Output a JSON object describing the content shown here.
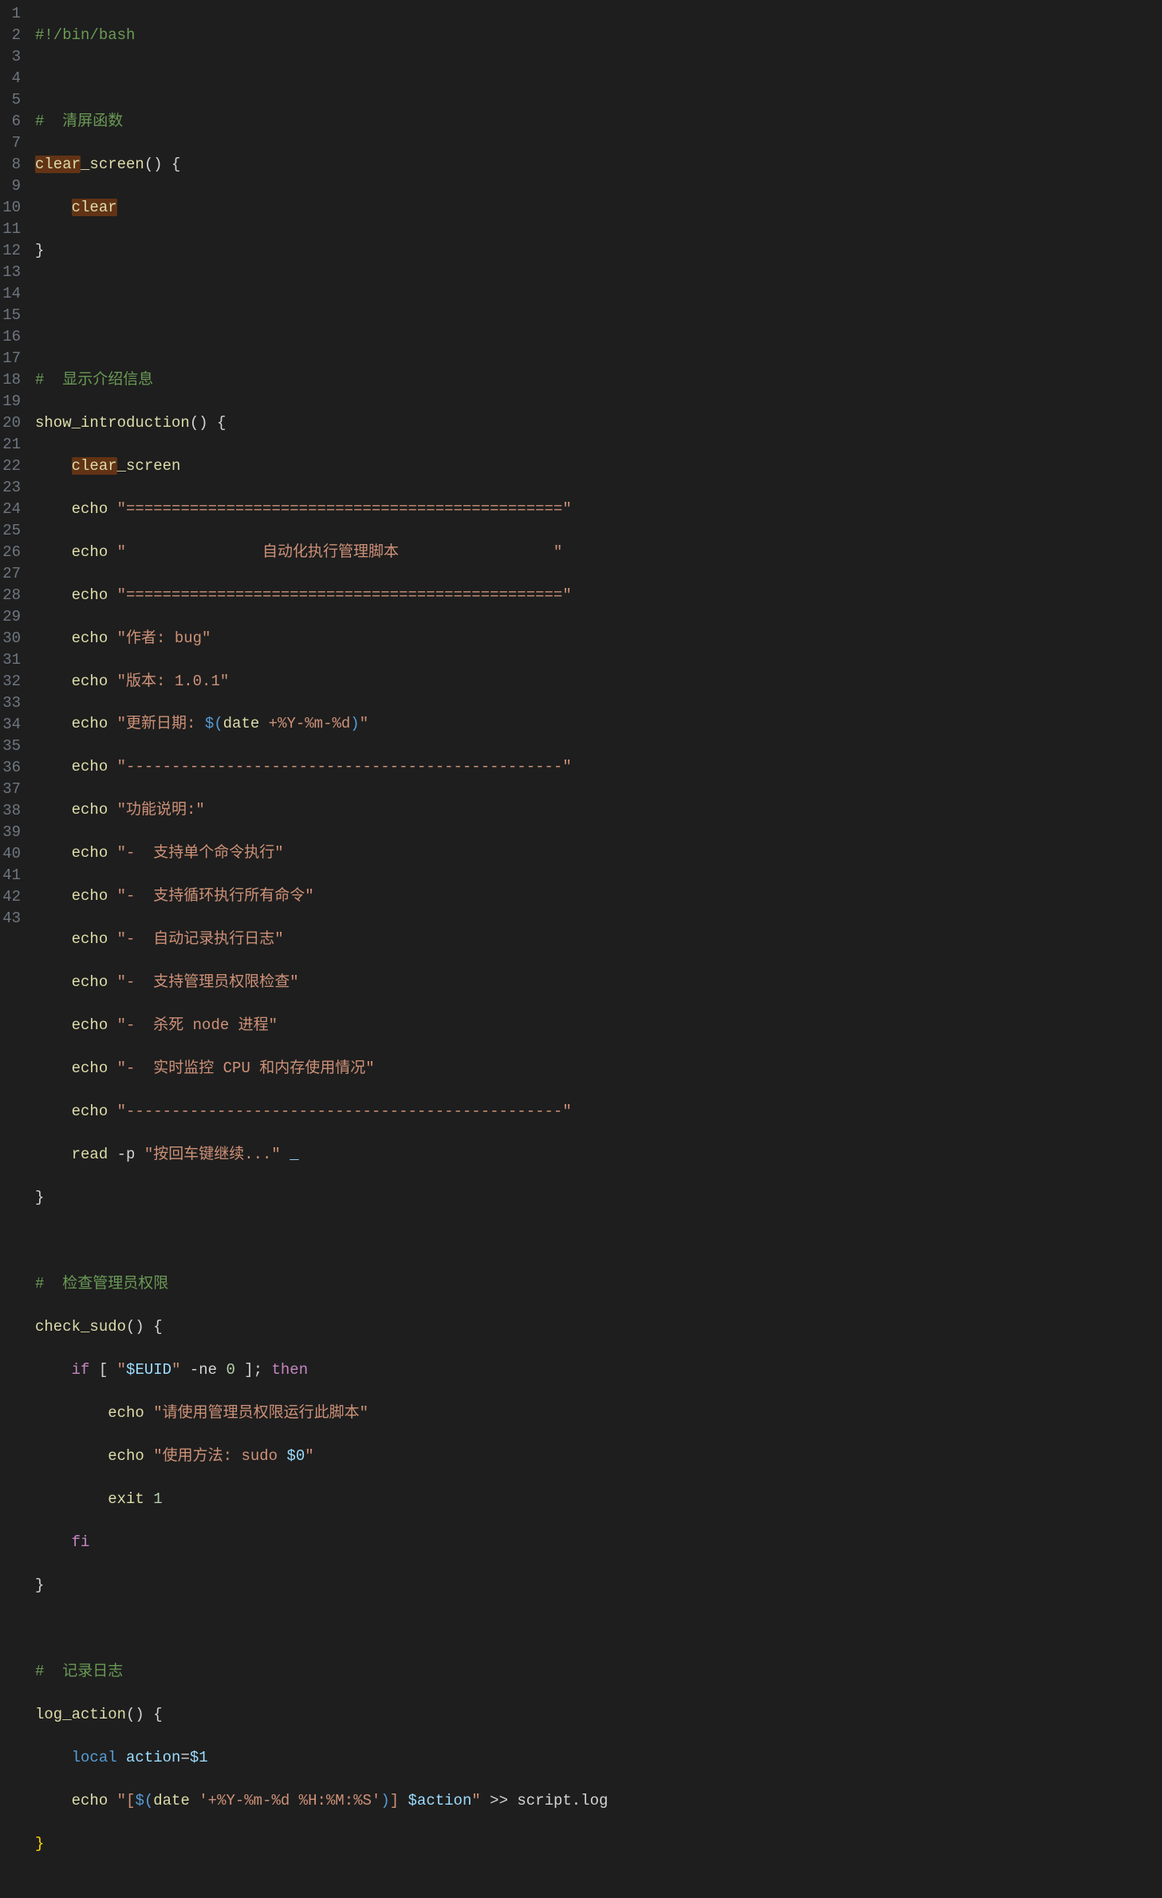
{
  "editor": {
    "line_start": 1,
    "line_end": 43
  },
  "lines": {
    "l1": "#!/bin/bash",
    "l3_comment": "#  清屏函数",
    "l4_fn": "clear",
    "l4_rest": "_screen",
    "l4_paren": "() {",
    "l5_clear": "clear",
    "l6_close": "}",
    "l9_comment": "#  显示介绍信息",
    "l10_fn": "show_introduction",
    "l10_paren": "() {",
    "l11_clear": "clear",
    "l11_rest": "_screen",
    "l12_echo": "echo",
    "l12_str": "\"================================================\"",
    "l13_echo": "echo",
    "l13_str": "\"               自动化执行管理脚本                 \"",
    "l14_echo": "echo",
    "l14_str": "\"================================================\"",
    "l15_echo": "echo",
    "l15_str": "\"作者: bug\"",
    "l16_echo": "echo",
    "l16_str": "\"版本: 1.0.1\"",
    "l17_echo": "echo",
    "l17_str_a": "\"更新日期: ",
    "l17_sub_open": "$(",
    "l17_date": "date",
    "l17_fmt": " +%Y-%m-%d",
    "l17_sub_close": ")",
    "l17_str_b": "\"",
    "l18_echo": "echo",
    "l18_str": "\"------------------------------------------------\"",
    "l19_echo": "echo",
    "l19_str": "\"功能说明:\"",
    "l20_echo": "echo",
    "l20_str": "\"-  支持单个命令执行\"",
    "l21_echo": "echo",
    "l21_str": "\"-  支持循环执行所有命令\"",
    "l22_echo": "echo",
    "l22_str": "\"-  自动记录执行日志\"",
    "l23_echo": "echo",
    "l23_str": "\"-  支持管理员权限检查\"",
    "l24_echo": "echo",
    "l24_str": "\"-  杀死 node 进程\"",
    "l25_echo": "echo",
    "l25_str": "\"-  实时监控 CPU 和内存使用情况\"",
    "l26_echo": "echo",
    "l26_str": "\"------------------------------------------------\"",
    "l27_read": "read",
    "l27_flag": " -p ",
    "l27_str": "\"按回车键继续...\"",
    "l27_var": " _",
    "l28_close": "}",
    "l30_comment": "#  检查管理员权限",
    "l31_fn": "check_sudo",
    "l31_paren": "() {",
    "l32_if": "if",
    "l32_bo": " [ ",
    "l32_q1": "\"",
    "l32_var": "$EUID",
    "l32_q2": "\"",
    "l32_op": " -ne ",
    "l32_zero": "0",
    "l32_bc": " ]; ",
    "l32_then": "then",
    "l33_echo": "echo",
    "l33_str": "\"请使用管理员权限运行此脚本\"",
    "l34_echo": "echo",
    "l34_str_a": "\"使用方法: sudo ",
    "l34_var": "$0",
    "l34_str_b": "\"",
    "l35_exit": "exit",
    "l35_num": " 1",
    "l36_fi": "fi",
    "l37_close": "}",
    "l39_comment": "#  记录日志",
    "l40_fn": "log_action",
    "l40_paren": "() {",
    "l41_local": "local",
    "l41_name": " action",
    "l41_eq": "=",
    "l41_val": "$1",
    "l42_echo": "echo",
    "l42_str_a": "\"[",
    "l42_sub_open": "$(",
    "l42_date": "date",
    "l42_fmt": " '+%Y-%m-%d %H:%M:%S'",
    "l42_sub_close": ")",
    "l42_str_b": "] ",
    "l42_var": "$action",
    "l42_str_c": "\"",
    "l42_redir": " >> script.log",
    "l43_close": "}"
  }
}
